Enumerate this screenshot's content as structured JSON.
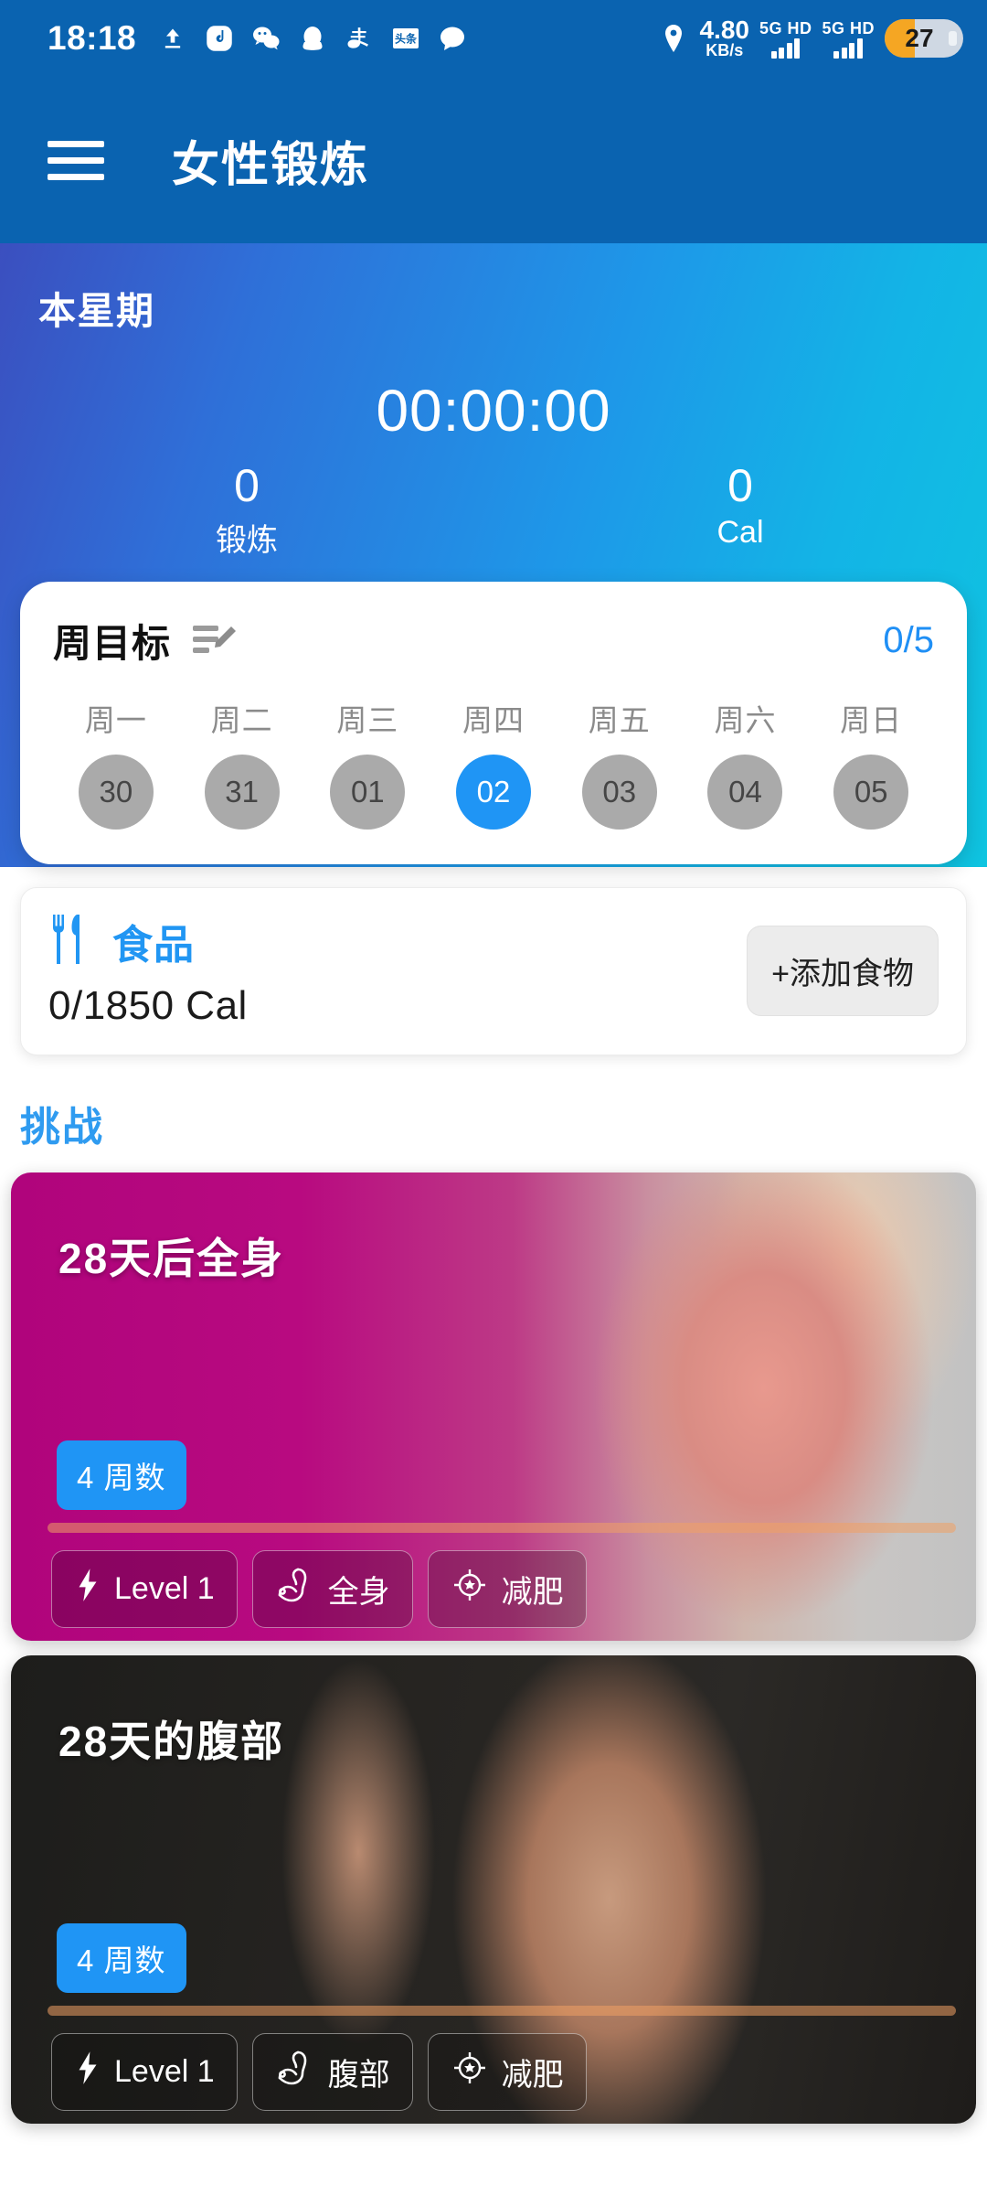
{
  "status_bar": {
    "time": "18:18",
    "left_icons": [
      "upload-icon",
      "douyin-icon",
      "wechat-icon",
      "qq-icon",
      "alipay-icon",
      "toutiao-icon",
      "message-icon"
    ],
    "location_icon": "location-pin-icon",
    "net_speed_value": "4.80",
    "net_speed_unit": "KB/s",
    "sim1_label": "5G HD",
    "sim2_label": "5G HD",
    "battery_percent": "27",
    "battery_color": "#f5a623"
  },
  "app_bar": {
    "menu_icon": "hamburger-menu-icon",
    "title": "女性锻炼",
    "background": "#0a63b0"
  },
  "hero": {
    "week_label": "本星期",
    "timer": "00:00:00",
    "stats": [
      {
        "value": "0",
        "label": "锻炼"
      },
      {
        "value": "0",
        "label": "Cal"
      }
    ],
    "gradient_from": "#3b4fbf",
    "gradient_to": "#0fc4e0"
  },
  "goal_card": {
    "title": "周目标",
    "edit_icon": "edit-list-icon",
    "count": "0/5",
    "accent": "#1f8ff5",
    "days": [
      {
        "name": "周一",
        "date": "30",
        "active": false
      },
      {
        "name": "周二",
        "date": "31",
        "active": false
      },
      {
        "name": "周三",
        "date": "01",
        "active": false
      },
      {
        "name": "周四",
        "date": "02",
        "active": true
      },
      {
        "name": "周五",
        "date": "03",
        "active": false
      },
      {
        "name": "周六",
        "date": "04",
        "active": false
      },
      {
        "name": "周日",
        "date": "05",
        "active": false
      }
    ]
  },
  "food_card": {
    "icon": "fork-knife-icon",
    "title": "食品",
    "calories": "0/1850 Cal",
    "add_button": "+添加食物",
    "accent": "#2196f3"
  },
  "challenge_section": {
    "title": "挑战",
    "title_color": "#2f9bf0",
    "cards": [
      {
        "title": "28天后全身",
        "weeks_badge": "4 周数",
        "tags": [
          {
            "icon": "lightning-bolt-icon",
            "label": "Level 1"
          },
          {
            "icon": "bicep-muscle-icon",
            "label": "全身"
          },
          {
            "icon": "target-icon",
            "label": "减肥"
          }
        ]
      },
      {
        "title": "28天的腹部",
        "weeks_badge": "4 周数",
        "tags": [
          {
            "icon": "lightning-bolt-icon",
            "label": "Level 1"
          },
          {
            "icon": "bicep-muscle-icon",
            "label": "腹部"
          },
          {
            "icon": "target-icon",
            "label": "减肥"
          }
        ]
      }
    ]
  }
}
